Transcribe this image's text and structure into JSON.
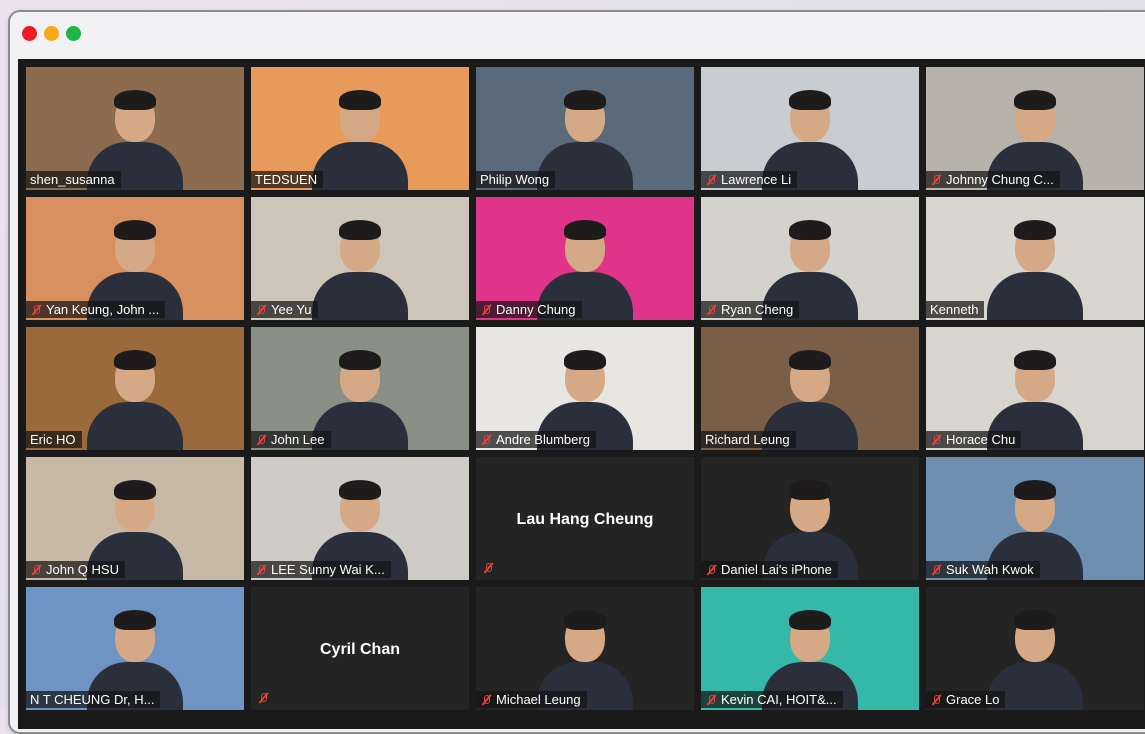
{
  "window": {
    "controls": [
      "close",
      "minimize",
      "maximize"
    ]
  },
  "participants": [
    {
      "name": "shen_susanna",
      "muted": false,
      "bg": "#8d6b4f",
      "video": true
    },
    {
      "name": "TEDSUEN",
      "muted": false,
      "bg": "#e89a5a",
      "video": true
    },
    {
      "name": "Philip Wong",
      "muted": false,
      "bg": "#5a6a7a",
      "video": true
    },
    {
      "name": "Lawrence Li",
      "muted": true,
      "bg": "#c9ccd0",
      "video": true
    },
    {
      "name": "Johnny Chung C...",
      "muted": true,
      "bg": "#b7b2aa",
      "video": true
    },
    {
      "name": "Yan Keung, John ...",
      "muted": true,
      "bg": "#d99060",
      "video": true
    },
    {
      "name": "Yee Yu",
      "muted": true,
      "bg": "#cfc6bb",
      "video": true
    },
    {
      "name": "Danny Chung",
      "muted": true,
      "bg": "#e0338a",
      "video": true
    },
    {
      "name": "Ryan Cheng",
      "muted": true,
      "bg": "#d4d2cc",
      "video": true
    },
    {
      "name": "Kenneth",
      "muted": false,
      "bg": "#d9d6d0",
      "video": true
    },
    {
      "name": "Eric HO",
      "muted": false,
      "bg": "#9a6a3a",
      "video": true
    },
    {
      "name": "John Lee",
      "muted": true,
      "bg": "#8a8f86",
      "video": true
    },
    {
      "name": "Andre Blumberg",
      "muted": true,
      "bg": "#e8e6e3",
      "video": true
    },
    {
      "name": "Richard Leung",
      "muted": false,
      "bg": "#7a5e48",
      "video": true
    },
    {
      "name": "Horace Chu",
      "muted": true,
      "bg": "#d8d4ce",
      "video": true
    },
    {
      "name": "John Q HSU",
      "muted": true,
      "bg": "#c8b8a6",
      "video": true
    },
    {
      "name": "LEE Sunny Wai K...",
      "muted": true,
      "bg": "#cfcbc6",
      "video": true
    },
    {
      "name": "Lau Hang Cheung",
      "muted": true,
      "bg": "#242424",
      "video": false
    },
    {
      "name": "Daniel Lai's iPhone",
      "muted": true,
      "bg": "#242424",
      "video": true
    },
    {
      "name": "Suk Wah Kwok",
      "muted": true,
      "bg": "#6f8fb0",
      "video": true
    },
    {
      "name": "N T CHEUNG Dr, H...",
      "muted": false,
      "bg": "#6f93c2",
      "video": true
    },
    {
      "name": "Cyril Chan",
      "muted": true,
      "bg": "#242424",
      "video": false
    },
    {
      "name": "Michael Leung",
      "muted": true,
      "bg": "#242424",
      "video": true
    },
    {
      "name": "Kevin CAI, HOIT&...",
      "muted": true,
      "bg": "#35b8a8",
      "video": true
    },
    {
      "name": "Grace Lo",
      "muted": true,
      "bg": "#242424",
      "video": true
    }
  ]
}
